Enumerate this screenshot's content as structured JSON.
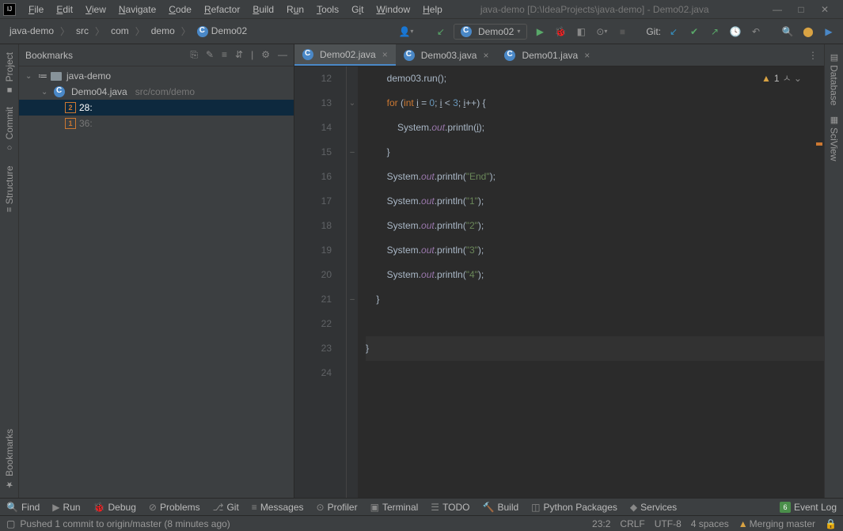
{
  "title": "java-demo [D:\\IdeaProjects\\java-demo] - Demo02.java",
  "menu": [
    "File",
    "Edit",
    "View",
    "Navigate",
    "Code",
    "Refactor",
    "Build",
    "Run",
    "Tools",
    "Git",
    "Window",
    "Help"
  ],
  "breadcrumb": [
    "java-demo",
    "src",
    "com",
    "demo",
    "Demo02"
  ],
  "runConfig": "Demo02",
  "gitLabel": "Git:",
  "leftTabs": {
    "project": "Project",
    "commit": "Commit",
    "structure": "Structure",
    "bookmarks": "Bookmarks"
  },
  "rightTabs": {
    "database": "Database",
    "sciview": "SciView"
  },
  "bookmarksPanel": {
    "title": "Bookmarks",
    "tree": {
      "root": "java-demo",
      "file": "Demo04.java",
      "filePath": "src/com/demo",
      "items": [
        {
          "num": "2",
          "label": "28:"
        },
        {
          "num": "1",
          "label": "36:"
        }
      ]
    }
  },
  "tabs": [
    {
      "name": "Demo02.java",
      "active": true
    },
    {
      "name": "Demo03.java",
      "active": false
    },
    {
      "name": "Demo01.java",
      "active": false
    }
  ],
  "warnings": "1",
  "code": {
    "startLine": 12,
    "lines": [
      {
        "n": 12,
        "html": "        demo03.run();"
      },
      {
        "n": 13,
        "html": "        <span class='kw'>for</span> (<span class='kw'>int</span> <u>i</u> = <span class='num'>0</span>; <u>i</u> &lt; <span class='num'>3</span>; <u>i</u>++) {"
      },
      {
        "n": 14,
        "html": "            System.<span class='field'>out</span>.println(<u>i</u>);"
      },
      {
        "n": 15,
        "html": "        }"
      },
      {
        "n": 16,
        "html": "        System.<span class='field'>out</span>.println(<span class='str'>\"End\"</span>);"
      },
      {
        "n": 17,
        "html": "        System.<span class='field'>out</span>.println(<span class='str'>\"1\"</span>);"
      },
      {
        "n": 18,
        "html": "        System.<span class='field'>out</span>.println(<span class='str'>\"2\"</span>);"
      },
      {
        "n": 19,
        "html": "        System.<span class='field'>out</span>.println(<span class='str'>\"3\"</span>);"
      },
      {
        "n": 20,
        "html": "        System.<span class='field'>out</span>.println(<span class='str'>\"4\"</span>);"
      },
      {
        "n": 21,
        "html": "    }"
      },
      {
        "n": 22,
        "html": ""
      },
      {
        "n": 23,
        "html": "}",
        "current": true
      },
      {
        "n": 24,
        "html": ""
      }
    ]
  },
  "toolWindows": [
    "Find",
    "Run",
    "Debug",
    "Problems",
    "Git",
    "Messages",
    "Profiler",
    "Terminal",
    "TODO",
    "Build",
    "Python Packages",
    "Services",
    "Event Log"
  ],
  "status": {
    "left": "Pushed 1 commit to origin/master (8 minutes ago)",
    "pos": "23:2",
    "lineEnd": "CRLF",
    "encoding": "UTF-8",
    "indent": "4 spaces",
    "branch": "Merging master"
  }
}
